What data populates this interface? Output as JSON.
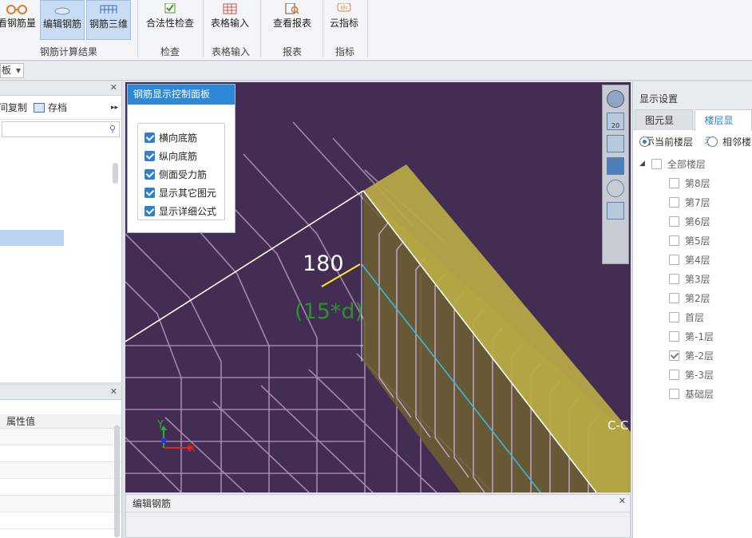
{
  "ribbon": {
    "buttons": [
      {
        "label": "看钢筋量",
        "icon": "glasses-icon"
      },
      {
        "label": "编辑钢筋",
        "icon": "edit-rebar-icon"
      },
      {
        "label": "钢筋三维",
        "icon": "rebar-3d-icon"
      },
      {
        "label": "合法性检查",
        "icon": "check-icon"
      },
      {
        "label": "表格输入",
        "icon": "table-input-icon"
      },
      {
        "label": "查看报表",
        "icon": "report-icon"
      },
      {
        "label": "云指标",
        "icon": "cloud-index-icon"
      }
    ],
    "groups": [
      "钢筋计算结果",
      "检查",
      "表格输入",
      "报表",
      "指标"
    ]
  },
  "subbar": {
    "dropdown_value": "板"
  },
  "left_panel": {
    "tool_copy": "间复制",
    "tool_save": "存档",
    "more": "▸▸"
  },
  "prop_panel": {
    "header": "属性值"
  },
  "control_panel": {
    "title": "钢筋显示控制面板",
    "options": [
      "横向底筋",
      "纵向底筋",
      "侧面受力筋",
      "显示其它图元",
      "显示详细公式"
    ]
  },
  "view": {
    "dim_value": "180",
    "dim_formula": "(15*d)",
    "axis_x": "X",
    "axis_y": "Y",
    "section_label": "C-C"
  },
  "edit_panel": {
    "title": "编辑钢筋"
  },
  "right_panel": {
    "title": "显示设置",
    "tabs": [
      "图元显示",
      "楼层显示"
    ],
    "radios": [
      "当前楼层",
      "相邻楼"
    ],
    "tree_root": "全部楼层",
    "floors": [
      {
        "label": "第8层",
        "checked": false
      },
      {
        "label": "第7层",
        "checked": false
      },
      {
        "label": "第6层",
        "checked": false
      },
      {
        "label": "第5层",
        "checked": false
      },
      {
        "label": "第4层",
        "checked": false
      },
      {
        "label": "第3层",
        "checked": false
      },
      {
        "label": "第2层",
        "checked": false
      },
      {
        "label": "首层",
        "checked": false
      },
      {
        "label": "第-1层",
        "checked": false
      },
      {
        "label": "第-2层",
        "checked": true
      },
      {
        "label": "第-3层",
        "checked": false
      },
      {
        "label": "基础层",
        "checked": false
      }
    ]
  },
  "colors": {
    "viewport_bg": "#432d52",
    "slab": "#b8ab45",
    "accent": "#2e88d8"
  }
}
